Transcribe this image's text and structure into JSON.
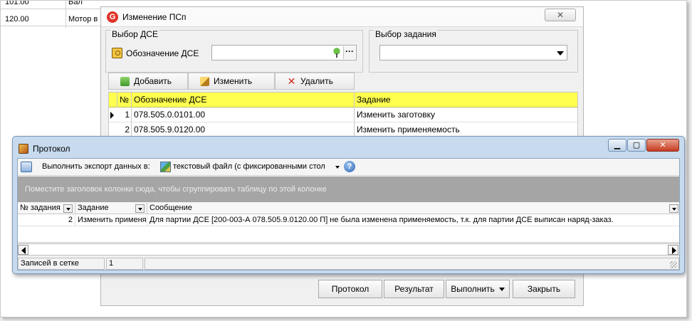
{
  "background_grid": {
    "rows": [
      {
        "c1": "101.00",
        "c2": "Вал"
      },
      {
        "c1": "120.00",
        "c2": "Мотор в"
      }
    ]
  },
  "main_dialog": {
    "title": "Изменение ПСп",
    "app_icon_glyph": "G",
    "close_glyph": "✕",
    "dse_group": {
      "label": "Выбор ДСЕ",
      "field_label": "Обозначение ДСЕ",
      "field_value": "",
      "ellipsis": "···"
    },
    "job_group": {
      "label": "Выбор задания",
      "selected": ""
    },
    "toolbar": {
      "add": "Добавить",
      "edit": "Изменить",
      "delete": "Удалить",
      "delete_glyph": "✕"
    },
    "grid": {
      "headers": [
        "№",
        "Обозначение ДСЕ",
        "Задание"
      ],
      "rows": [
        {
          "num": "1",
          "dse": "078.505.0.0101.00",
          "task": "Изменить заготовку"
        },
        {
          "num": "2",
          "dse": "078.505.9.0120.00",
          "task": "Изменить применяемость"
        }
      ]
    },
    "buttons": {
      "protocol": "Протокол",
      "result": "Результат",
      "execute": "Выполнить",
      "close": "Закрыть"
    }
  },
  "protocol_window": {
    "title": "Протокол",
    "window_buttons": {
      "minimize": "▁",
      "maximize": "▢",
      "close": "✕"
    },
    "export_label": "Выполнить экспорт данных в:",
    "export_value": "текстовый файл (с фиксированными стол",
    "help_glyph": "?",
    "group_panel_text": "Поместите заголовок колонки сюда, чтобы сгруппировать таблицу по этой колонке",
    "grid": {
      "headers": [
        "№ задания",
        "Задание",
        "Сообщение"
      ],
      "rows": [
        {
          "num": "2",
          "task": "Изменить применя",
          "message": "Для партии ДСЕ [200-003-А 078.505.9.0120.00 П] не была изменена применяемость, т.к. для партии ДСЕ выписан наряд-заказ."
        }
      ]
    },
    "status": {
      "label": "Записей в сетке",
      "count": "1"
    }
  }
}
